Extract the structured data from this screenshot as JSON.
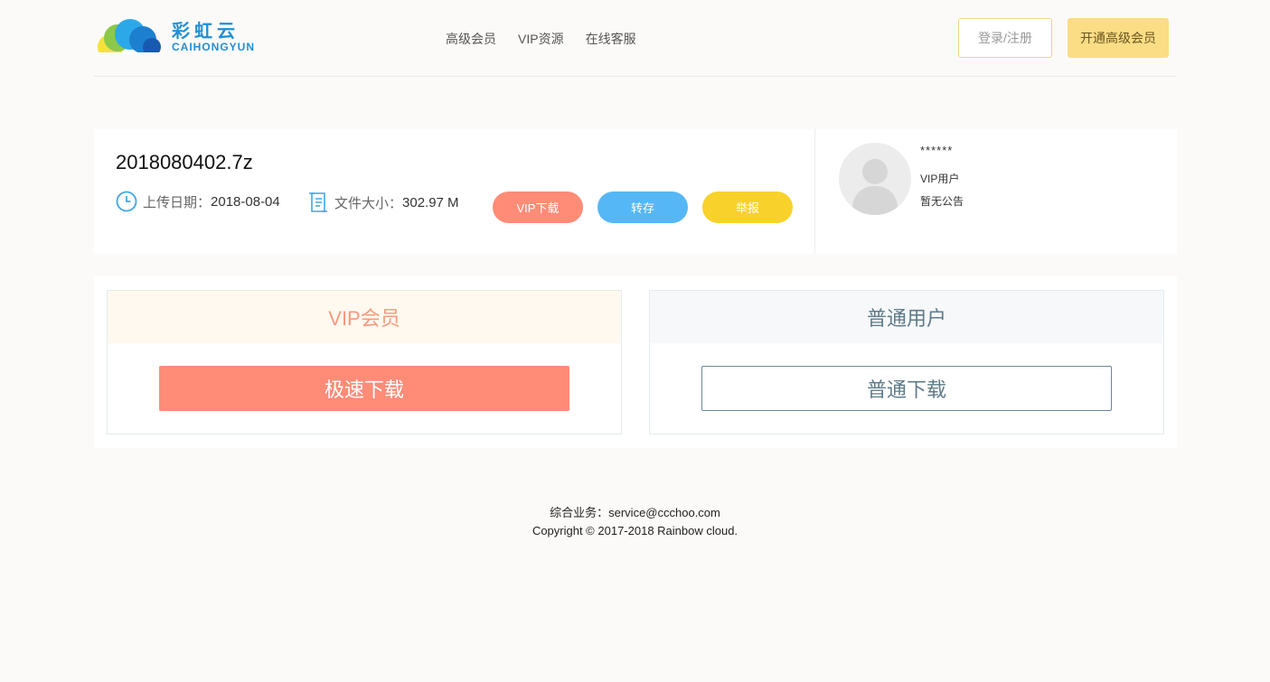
{
  "header": {
    "logo_cn": "彩虹云",
    "logo_en": "CAIHONGYUN",
    "nav": [
      "高级会员",
      "VIP资源",
      "在线客服"
    ],
    "login_label": "登录/注册",
    "open_vip_label": "开通高级会员"
  },
  "file": {
    "name": "2018080402.7z",
    "date_label": "上传日期：",
    "date_value": "2018-08-04",
    "size_label": "文件大小：",
    "size_value": "302.97 M",
    "actions": {
      "vip_download": "VIP下载",
      "save": "转存",
      "report": "举报"
    }
  },
  "user": {
    "name": "******",
    "type": "VIP用户",
    "notice": "暂无公告"
  },
  "plans": {
    "vip": {
      "title": "VIP会员",
      "button": "极速下载"
    },
    "free": {
      "title": "普通用户",
      "button": "普通下载"
    }
  },
  "footer": {
    "business": "综合业务：service@ccchoo.com",
    "copyright": "Copyright © 2017-2018 Rainbow cloud."
  },
  "colors": {
    "accent_gold": "#fbdd85",
    "vip_coral": "#fe8c77",
    "save_blue": "#55b7f5",
    "report_yellow": "#f8d22a",
    "brand_blue": "#1f8fd6"
  }
}
